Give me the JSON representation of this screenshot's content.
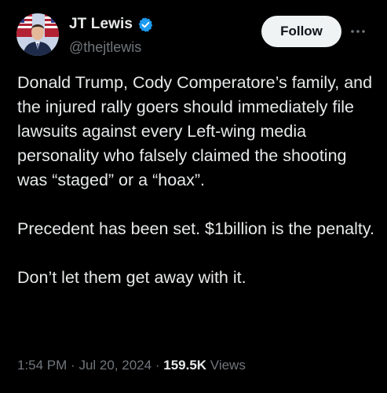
{
  "author": {
    "display_name": "JT Lewis",
    "handle": "@thejtlewis",
    "verified": true,
    "verified_color": "#1d9bf0"
  },
  "actions": {
    "follow_label": "Follow",
    "more_icon": "more-horizontal-icon"
  },
  "tweet": {
    "paragraphs": [
      "Donald Trump, Cody Comperatore’s family, and the injured rally goers should immediately file lawsuits against every Left-wing media personality who falsely claimed the shooting was “staged” or a “hoax”.",
      "Precedent has been set. $1billion is the penalty.",
      "Don’t let them get away with it."
    ]
  },
  "meta": {
    "time": "1:54 PM",
    "separator": "·",
    "date": "Jul 20, 2024",
    "views_count": "159.5K",
    "views_label": "Views"
  },
  "colors": {
    "background": "#000000",
    "text_primary": "#e7e9ea",
    "text_secondary": "#71767b",
    "follow_bg": "#eff3f4",
    "follow_text": "#0f1419"
  }
}
